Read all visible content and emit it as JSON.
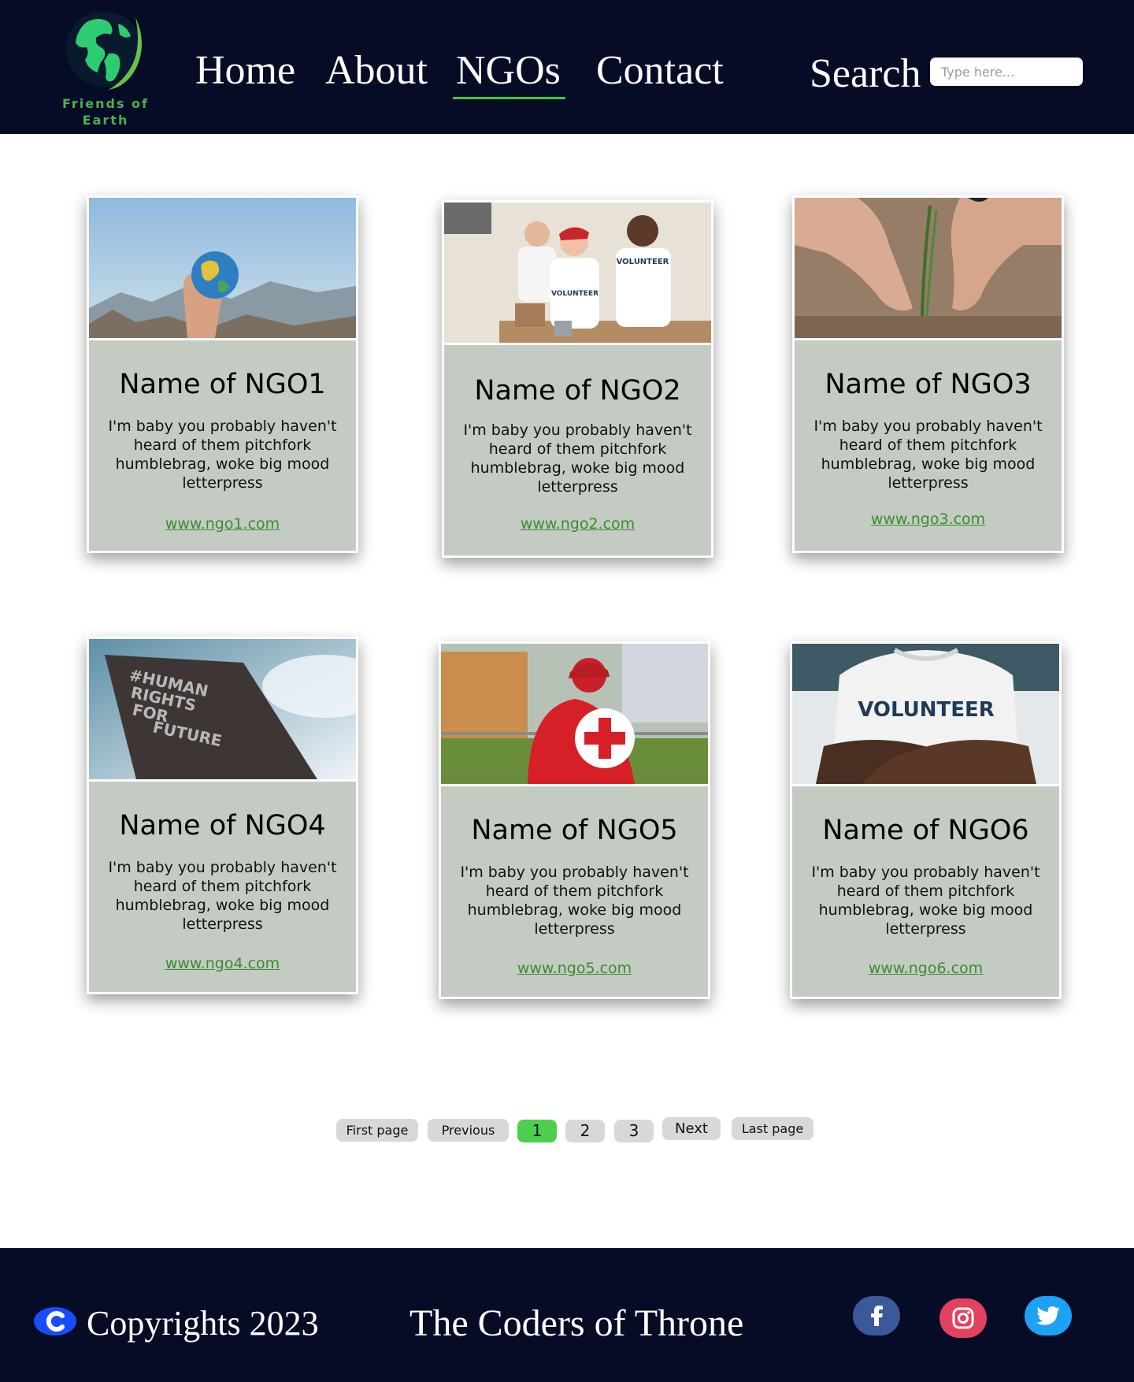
{
  "site": {
    "logo_text_line1": "Friends of",
    "logo_text_line2": "Earth",
    "brand_color": "#4caf50",
    "header_bg": "#060c26"
  },
  "nav": {
    "items": [
      {
        "label": "Home",
        "active": false
      },
      {
        "label": "About",
        "active": false
      },
      {
        "label": "NGOs",
        "active": true
      },
      {
        "label": "Contact",
        "active": false
      }
    ],
    "search_label": "Search",
    "search_placeholder": "Type here...",
    "active_underline_color": "#3ec63e"
  },
  "cards": [
    {
      "title": "Name of NGO1",
      "description": "I'm baby you probably haven't heard of them pitchfork humblebrag, woke big mood letterpress",
      "link": "www.ngo1.com",
      "image_icon": "globe-in-hand-photo"
    },
    {
      "title": "Name of NGO2",
      "description": "I'm baby you probably haven't heard of them pitchfork humblebrag, woke big mood letterpress",
      "link": "www.ngo2.com",
      "image_icon": "volunteers-photo"
    },
    {
      "title": "Name of NGO3",
      "description": "I'm baby you probably haven't heard of them pitchfork humblebrag, woke big mood letterpress",
      "link": "www.ngo3.com",
      "image_icon": "planting-hands-photo"
    },
    {
      "title": "Name of NGO4",
      "description": "I'm baby you probably haven't heard of them pitchfork humblebrag, woke big mood letterpress",
      "link": "www.ngo4.com",
      "image_icon": "protest-sign-photo",
      "image_text": [
        "#HUMAN",
        "RIGHTS",
        "FOR",
        "FUTURE"
      ]
    },
    {
      "title": "Name of NGO5",
      "description": "I'm baby you probably haven't heard of them pitchfork humblebrag, woke big mood letterpress",
      "link": "www.ngo5.com",
      "image_icon": "red-cross-worker-photo"
    },
    {
      "title": "Name of NGO6",
      "description": "I'm baby you probably haven't heard of them pitchfork humblebrag, woke big mood letterpress",
      "link": "www.ngo6.com",
      "image_icon": "volunteer-shirt-photo",
      "image_text": [
        "VOLUNTEER"
      ]
    }
  ],
  "volunteer_shirt_text": "VOLUNTEER",
  "card_bg": "#c3cbc3",
  "link_color": "#3b8c2f",
  "pagination": {
    "first": "First page",
    "previous": "Previous",
    "pages": [
      "1",
      "2",
      "3"
    ],
    "current": "1",
    "next": "Next",
    "last": "Last page",
    "active_color": "#4ccf4c"
  },
  "footer": {
    "copyright": "Copyrights 2023",
    "team": "The Coders of Throne",
    "social": [
      {
        "name": "facebook-icon",
        "color": "#3b5998"
      },
      {
        "name": "instagram-icon",
        "color": "#e4405f"
      },
      {
        "name": "twitter-icon",
        "color": "#1da1f2"
      }
    ]
  }
}
